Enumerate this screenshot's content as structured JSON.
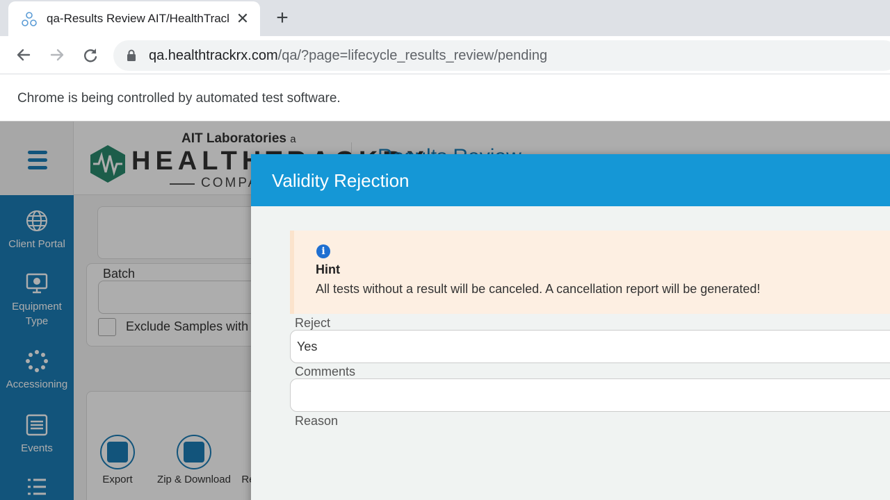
{
  "browser": {
    "tab_title": "qa-Results Review AIT/HealthTrackRx",
    "tab_close": "✕",
    "new_tab": "+",
    "url_host": "qa.healthtrackrx.com",
    "url_path": "/qa/?page=lifecycle_results_review/pending",
    "infobar_text": "Chrome is being controlled by automated test software."
  },
  "app": {
    "logo": {
      "top": "AIT Laboratories",
      "top_small": "a",
      "main": "HEALTHTRACKRX",
      "sub": "COMPANY"
    },
    "page_title": "Results Review",
    "sidebar": {
      "items": [
        {
          "label": "Client Portal",
          "icon": "globe-icon"
        },
        {
          "label": "Equipment Type",
          "icon": "monitor-icon"
        },
        {
          "label": "Accessioning",
          "icon": "spinner-icon"
        },
        {
          "label": "Events",
          "icon": "list-box-icon"
        },
        {
          "label": "",
          "icon": "list-icon"
        }
      ]
    },
    "filters": {
      "batch_label": "Batch",
      "exclude_label": "Exclude Samples with"
    },
    "actions": [
      {
        "label": "Export",
        "icon": "export-icon"
      },
      {
        "label": "Zip & Download",
        "icon": "upload-icon"
      },
      {
        "label": "Re",
        "icon": ""
      }
    ]
  },
  "modal": {
    "title": "Validity Rejection",
    "hint": {
      "icon": "info-icon",
      "icon_glyph": "i",
      "title": "Hint",
      "text": "All tests without a result will be canceled. A cancellation report will be generated!"
    },
    "fields": {
      "reject_label": "Reject",
      "reject_value": "Yes",
      "comments_label": "Comments",
      "comments_value": "",
      "reason_label": "Reason"
    }
  },
  "colors": {
    "accent": "#1597d6",
    "sidebar": "#1b7cb6",
    "hint_bg": "#fdefe2"
  }
}
